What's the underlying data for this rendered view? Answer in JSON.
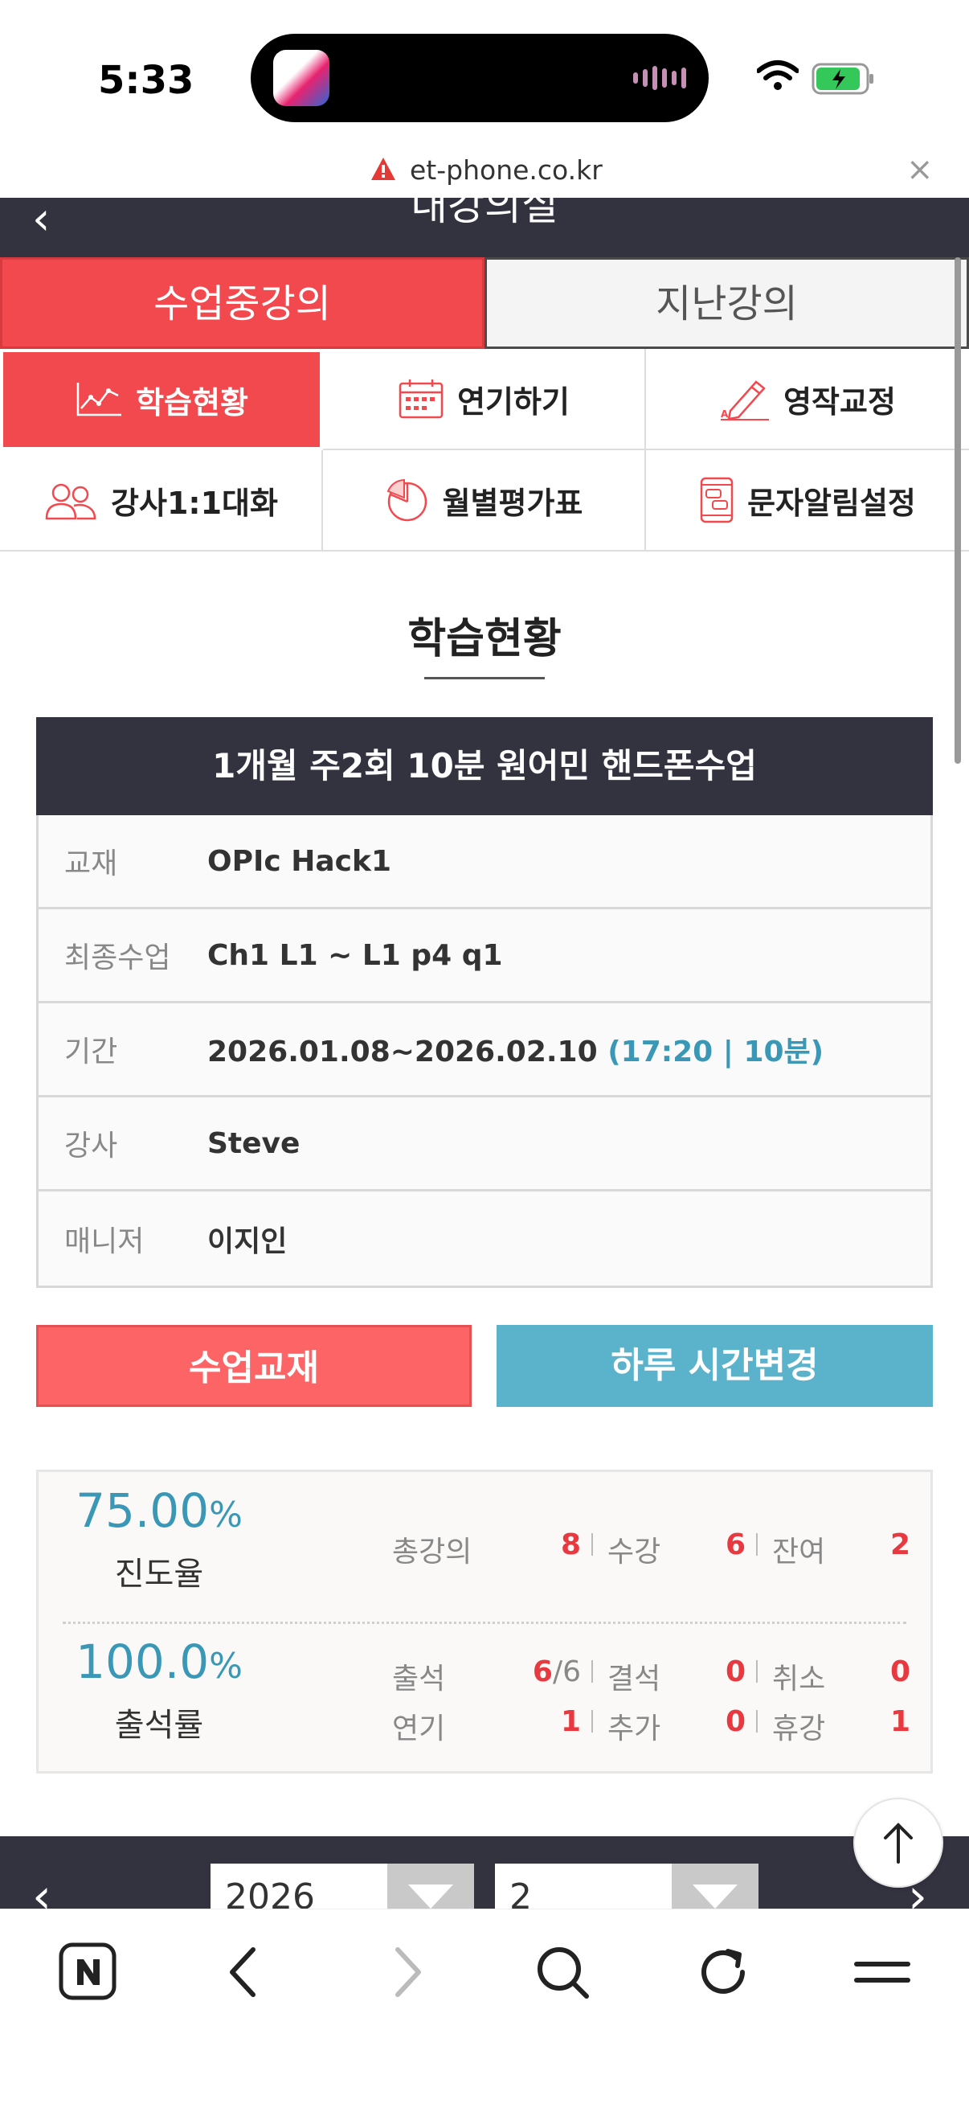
{
  "status": {
    "time": "5:33"
  },
  "browser": {
    "url": "et-phone.co.kr",
    "close_label": "×"
  },
  "header": {
    "title": "내강의실",
    "back_label": "‹"
  },
  "main_tabs": [
    {
      "label": "수업중강의",
      "active": true
    },
    {
      "label": "지난강의",
      "active": false
    }
  ],
  "menu": [
    {
      "label": "학습현황",
      "icon": "chart-icon",
      "active": true
    },
    {
      "label": "연기하기",
      "icon": "calendar-icon",
      "active": false
    },
    {
      "label": "영작교정",
      "icon": "pencil-icon",
      "active": false
    },
    {
      "label": "강사1:1대화",
      "icon": "people-icon",
      "active": false
    },
    {
      "label": "월별평가표",
      "icon": "pie-chart-icon",
      "active": false
    },
    {
      "label": "문자알림설정",
      "icon": "phone-message-icon",
      "active": false
    }
  ],
  "section": {
    "title": "학습현황"
  },
  "course": {
    "title": "1개월 주2회 10분 원어민 핸드폰수업",
    "rows": [
      {
        "label": "교재",
        "value": "OPIc Hack1",
        "extra": ""
      },
      {
        "label": "최종수업",
        "value": "Ch1 L1 ~ L1 p4 q1",
        "extra": ""
      },
      {
        "label": "기간",
        "value": "2026.01.08~2026.02.10 ",
        "extra": "(17:20 | 10분)"
      },
      {
        "label": "강사",
        "value": "Steve",
        "extra": ""
      },
      {
        "label": "매니저",
        "value": "이지인",
        "extra": ""
      }
    ]
  },
  "buttons": {
    "material": "수업교재",
    "change_time": "하루 시간변경"
  },
  "stats": {
    "progress": {
      "value": "75.00",
      "unit": "%",
      "label": "진도율"
    },
    "attendance": {
      "value": "100.0",
      "unit": "%",
      "label": "출석률"
    },
    "progress_items": [
      {
        "label": "총강의",
        "value": "8"
      },
      {
        "label": "수강",
        "value": "6"
      },
      {
        "label": "잔여",
        "value": "2"
      }
    ],
    "attendance_items": [
      {
        "label": "출석",
        "value": "6",
        "suffix": "/6"
      },
      {
        "label": "결석",
        "value": "0",
        "suffix": ""
      },
      {
        "label": "취소",
        "value": "0",
        "suffix": ""
      },
      {
        "label": "연기",
        "value": "1",
        "suffix": ""
      },
      {
        "label": "추가",
        "value": "0",
        "suffix": ""
      },
      {
        "label": "휴강",
        "value": "1",
        "suffix": ""
      }
    ]
  },
  "date_nav": {
    "year": "2026",
    "month": "2",
    "prev": "‹",
    "next": "›"
  },
  "colors": {
    "accent_red": "#f2494e",
    "accent_blue": "#5bb2cb",
    "header_dark": "#33323f"
  }
}
